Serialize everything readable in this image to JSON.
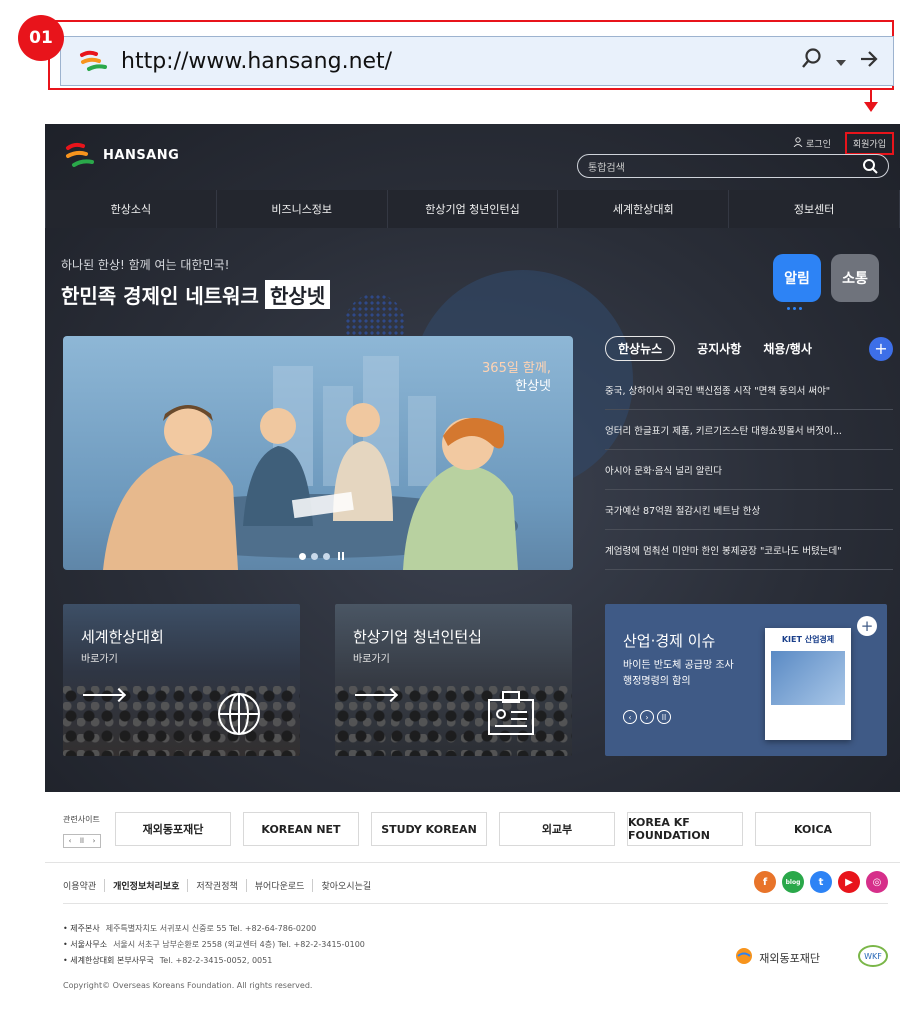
{
  "annotation": {
    "step": "01"
  },
  "address_bar": {
    "url": "http://www.hansang.net/"
  },
  "site": {
    "logo_text": "HANSANG",
    "util": {
      "login": "로그인",
      "join": "회원가입"
    },
    "search": {
      "placeholder": "통합검색"
    },
    "nav": [
      "한상소식",
      "비즈니스정보",
      "한상기업 청년인턴십",
      "세계한상대회",
      "정보센터"
    ],
    "hero": {
      "tagline": "하나된 한상! 함께 여는 대한민국!",
      "headline": "한민족 경제인 네트워크",
      "headline_highlight": "한상넷",
      "slide_caption_1": "365일 함께,",
      "slide_caption_2": "한상넷"
    },
    "notice_tabs": [
      "알림",
      "소통"
    ],
    "news": {
      "tabs": [
        "한상뉴스",
        "공지사항",
        "채용/행사"
      ],
      "plus": "+",
      "items": [
        "중국, 상하이서 외국인 백신접종 시작 \"면책 동의서 써야\"",
        "엉터리 한글표기 제품, 키르기즈스탄 대형쇼핑몰서 버젓이...",
        "아시아 문화·음식 널리 알린다",
        "국가예산 87억원 절감시킨 베트남 한상",
        "계엄령에 멈춰선 미얀마 한인 봉제공장 \"코로나도 버텼는데\""
      ]
    },
    "cards": [
      {
        "title": "세계한상대회",
        "sub": "바로가기"
      },
      {
        "title": "한상기업 청년인턴십",
        "sub": "바로가기"
      }
    ],
    "issue": {
      "title": "산업·경제 이슈",
      "desc": "바이든 반도체 공급망 조사 행정명령의 함의",
      "magazine": "KIET 산업경제",
      "plus": "+"
    },
    "related": {
      "label": "관련사이트",
      "logos": [
        "재외동포재단",
        "KOREAN NET",
        "STUDY KOREAN",
        "외교부",
        "KOREA KF FOUNDATION",
        "KOICA"
      ]
    },
    "footer": {
      "menu": [
        "이용약관",
        "개인정보처리보호",
        "저작권정책",
        "뷰어다운로드",
        "찾아오시는길"
      ],
      "social": [
        "f",
        "blog",
        "t",
        "▶",
        "◎"
      ],
      "info": [
        {
          "k": "• 제주본사",
          "v": "제주특별자치도 서귀포시 신중로 55   Tel. +82-64-786-0200"
        },
        {
          "k": "• 서울사무소",
          "v": "서울시 서초구 남부순환로 2558 (외교센터 4층)   Tel. +82-2-3415-0100"
        },
        {
          "k": "• 세계한상대회 본부사무국",
          "v": "Tel. +82-2-3415-0052, 0051"
        }
      ],
      "copyright": "Copyright© Overseas Koreans Foundation. All rights reserved.",
      "brand": "재외동포재단",
      "badge": "WKF"
    }
  }
}
